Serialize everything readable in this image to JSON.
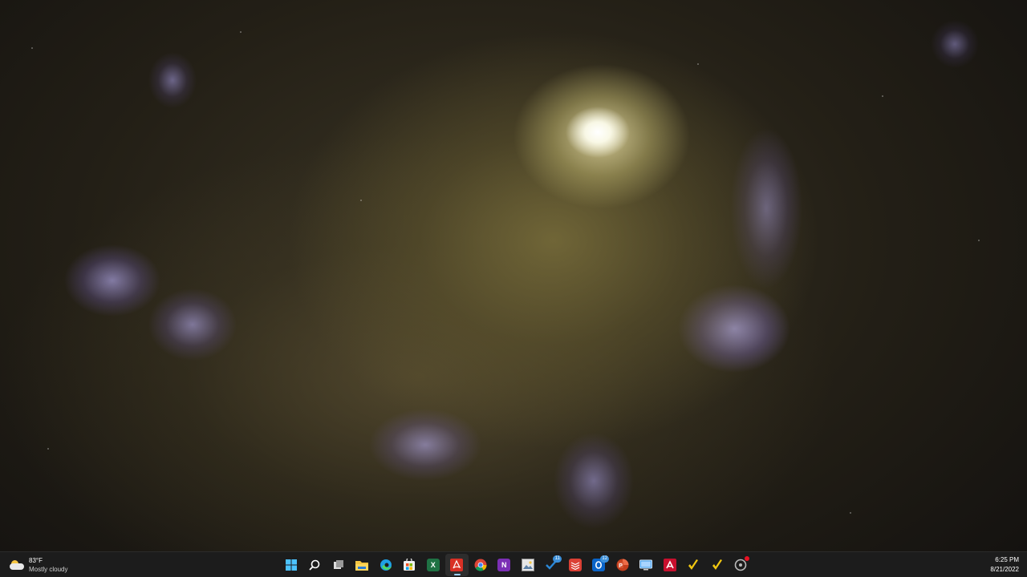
{
  "wallpaper": {
    "description_colors": {
      "core": "#fffbe6",
      "arms": "#8a7b44",
      "star_regions": "#b7a8ff",
      "background": "#141210"
    }
  },
  "taskbar": {
    "background": "#1c1c1c",
    "weather": {
      "icon": "partly-cloudy-icon",
      "temperature": "83°F",
      "condition": "Mostly cloudy"
    },
    "apps": [
      {
        "name": "start-button",
        "icon": "windows-logo-icon",
        "color": "#4cc2ff"
      },
      {
        "name": "search-button",
        "icon": "search-icon",
        "color": "#ffffff"
      },
      {
        "name": "task-view-button",
        "icon": "task-view-icon",
        "color": "#cccccc"
      },
      {
        "name": "file-explorer-button",
        "icon": "folder-icon",
        "color": "#f4c542"
      },
      {
        "name": "edge-button",
        "icon": "edge-icon",
        "color": "#1fa0e3"
      },
      {
        "name": "microsoft-store-button",
        "icon": "store-icon",
        "color": "#ffffff"
      },
      {
        "name": "excel-button",
        "icon": "excel-icon",
        "color": "#1f7244",
        "letter": "X"
      },
      {
        "name": "acrobat-button",
        "icon": "pdf-icon",
        "color": "#d93025",
        "active": true
      },
      {
        "name": "chrome-button",
        "icon": "chrome-icon",
        "color": "#4285f4"
      },
      {
        "name": "onenote-button",
        "icon": "onenote-icon",
        "color": "#7b2fb5",
        "letter": "N"
      },
      {
        "name": "photos-button",
        "icon": "image-icon",
        "color": "#9ab"
      },
      {
        "name": "tasks-button",
        "icon": "checkmark-icon",
        "color": "#2b88d8",
        "badge": "11"
      },
      {
        "name": "todoist-button",
        "icon": "layers-icon",
        "color": "#db4035"
      },
      {
        "name": "outlook-button",
        "icon": "outlook-icon",
        "color": "#0a64c8",
        "badge": "12"
      },
      {
        "name": "powerpoint-button",
        "icon": "powerpoint-icon",
        "color": "#c43e1c"
      },
      {
        "name": "remote-desktop-button",
        "icon": "monitor-icon",
        "color": "#3d9be9"
      },
      {
        "name": "app-red-button",
        "icon": "red-app-icon",
        "color": "#c8102e"
      },
      {
        "name": "app-norton-1-button",
        "icon": "yellow-check-icon",
        "color": "#f2c811"
      },
      {
        "name": "app-norton-2-button",
        "icon": "yellow-check-icon",
        "color": "#f2c811"
      },
      {
        "name": "snipping-button",
        "icon": "gear-circle-icon",
        "color": "#bbbbbb",
        "dot": true
      }
    ],
    "clock": {
      "time": "6:25 PM",
      "date": "8/21/2022"
    }
  }
}
